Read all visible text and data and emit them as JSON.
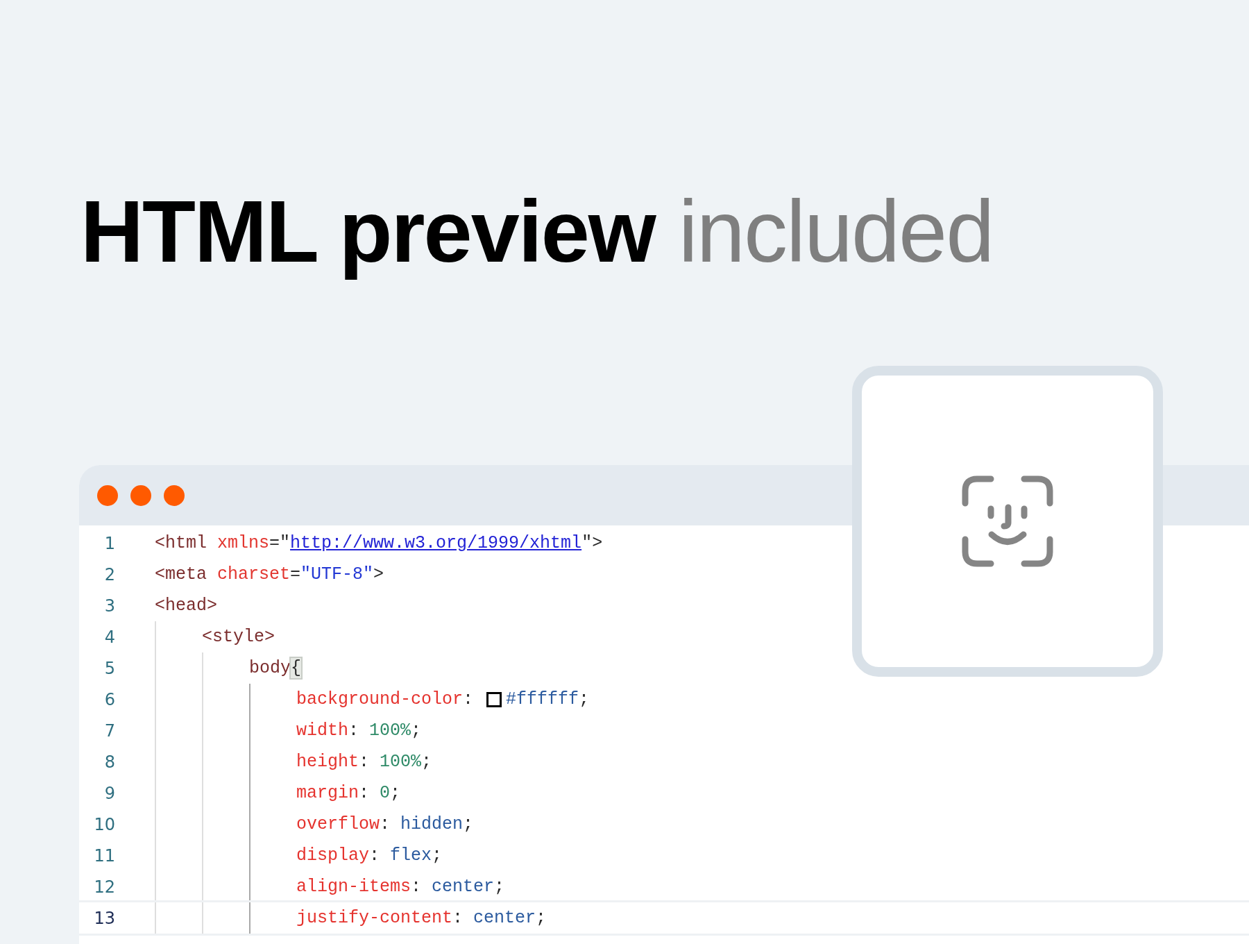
{
  "headline": {
    "strong": "HTML preview",
    "light": "included"
  },
  "editor": {
    "lines": [
      {
        "number": "1",
        "current": false,
        "tokens": [
          {
            "text": "<html",
            "kind": "tag"
          },
          {
            "text": " xmlns",
            "kind": "attr"
          },
          {
            "text": "=\"",
            "kind": "punct"
          },
          {
            "text": "http://www.w3.org/1999/xhtml",
            "kind": "link"
          },
          {
            "text": "\">",
            "kind": "punct"
          }
        ]
      },
      {
        "number": "2",
        "current": false,
        "tokens": [
          {
            "text": "<meta",
            "kind": "tag"
          },
          {
            "text": " charset",
            "kind": "attr"
          },
          {
            "text": "=",
            "kind": "punct"
          },
          {
            "text": "\"UTF-8\"",
            "kind": "string"
          },
          {
            "text": ">",
            "kind": "punct"
          }
        ]
      },
      {
        "number": "3",
        "current": false,
        "tokens": [
          {
            "text": "<head>",
            "kind": "tag"
          }
        ],
        "children": [
          {
            "number": "4",
            "current": false,
            "tokens": [
              {
                "text": "<style>",
                "kind": "tag"
              }
            ],
            "children": [
              {
                "number": "5",
                "current": false,
                "tokens": [
                  {
                    "text": "body",
                    "kind": "tag"
                  },
                  {
                    "text": "{",
                    "kind": "bracket"
                  }
                ],
                "children": [
                  {
                    "number": "6",
                    "current": false,
                    "tokens": [
                      {
                        "text": "background-color",
                        "kind": "prop"
                      },
                      {
                        "text": ": ",
                        "kind": "punct"
                      },
                      {
                        "kind": "swatch",
                        "color": "#ffffff"
                      },
                      {
                        "text": "#ffffff",
                        "kind": "value"
                      },
                      {
                        "text": ";",
                        "kind": "punct"
                      }
                    ]
                  },
                  {
                    "number": "7",
                    "current": false,
                    "tokens": [
                      {
                        "text": "width",
                        "kind": "prop"
                      },
                      {
                        "text": ": ",
                        "kind": "punct"
                      },
                      {
                        "text": "100%",
                        "kind": "number"
                      },
                      {
                        "text": ";",
                        "kind": "punct"
                      }
                    ]
                  },
                  {
                    "number": "8",
                    "current": false,
                    "tokens": [
                      {
                        "text": "height",
                        "kind": "prop"
                      },
                      {
                        "text": ": ",
                        "kind": "punct"
                      },
                      {
                        "text": "100%",
                        "kind": "number"
                      },
                      {
                        "text": ";",
                        "kind": "punct"
                      }
                    ]
                  },
                  {
                    "number": "9",
                    "current": false,
                    "tokens": [
                      {
                        "text": "margin",
                        "kind": "prop"
                      },
                      {
                        "text": ": ",
                        "kind": "punct"
                      },
                      {
                        "text": "0",
                        "kind": "number"
                      },
                      {
                        "text": ";",
                        "kind": "punct"
                      }
                    ]
                  },
                  {
                    "number": "10",
                    "current": false,
                    "tokens": [
                      {
                        "text": "overflow",
                        "kind": "prop"
                      },
                      {
                        "text": ": ",
                        "kind": "punct"
                      },
                      {
                        "text": "hidden",
                        "kind": "value"
                      },
                      {
                        "text": ";",
                        "kind": "punct"
                      }
                    ]
                  },
                  {
                    "number": "11",
                    "current": false,
                    "tokens": [
                      {
                        "text": "display",
                        "kind": "prop"
                      },
                      {
                        "text": ": ",
                        "kind": "punct"
                      },
                      {
                        "text": "flex",
                        "kind": "value"
                      },
                      {
                        "text": ";",
                        "kind": "punct"
                      }
                    ]
                  },
                  {
                    "number": "12",
                    "current": false,
                    "tokens": [
                      {
                        "text": "align-items",
                        "kind": "prop"
                      },
                      {
                        "text": ": ",
                        "kind": "punct"
                      },
                      {
                        "text": "center",
                        "kind": "value"
                      },
                      {
                        "text": ";",
                        "kind": "punct"
                      }
                    ]
                  },
                  {
                    "number": "13",
                    "current": true,
                    "tokens": [
                      {
                        "text": "justify-content",
                        "kind": "prop"
                      },
                      {
                        "text": ": ",
                        "kind": "punct"
                      },
                      {
                        "text": "center",
                        "kind": "value"
                      },
                      {
                        "text": ";",
                        "kind": "punct"
                      }
                    ]
                  }
                ]
              }
            ]
          }
        ]
      }
    ]
  }
}
